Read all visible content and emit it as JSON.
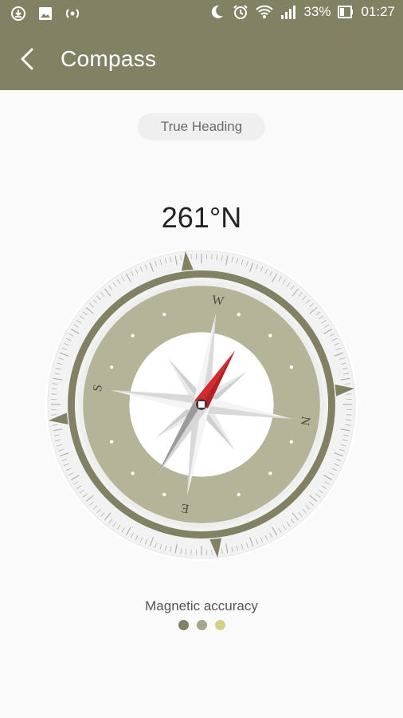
{
  "status_bar": {
    "left_icons": [
      "download-icon",
      "image-icon",
      "hotspot-icon"
    ],
    "right_icons": [
      "moon-icon",
      "alarm-icon",
      "wifi-icon",
      "signal-icon"
    ],
    "battery_percent": "33%",
    "time": "01:27"
  },
  "app_bar": {
    "title": "Compass",
    "back_icon": "back-arrow-icon"
  },
  "compass": {
    "mode_label": "True Heading",
    "heading": "261°N",
    "heading_degrees": 261,
    "cardinals": {
      "north": "N",
      "east": "E",
      "south": "S",
      "west": "W"
    }
  },
  "accuracy": {
    "label": "Magnetic accuracy",
    "dots": [
      {
        "color": "#838164"
      },
      {
        "color": "#a7a68a"
      },
      {
        "color": "#d8cf86"
      }
    ]
  },
  "colors": {
    "accent": "#838164",
    "dial": "#b5b398",
    "needle_red": "#d32a2e"
  }
}
